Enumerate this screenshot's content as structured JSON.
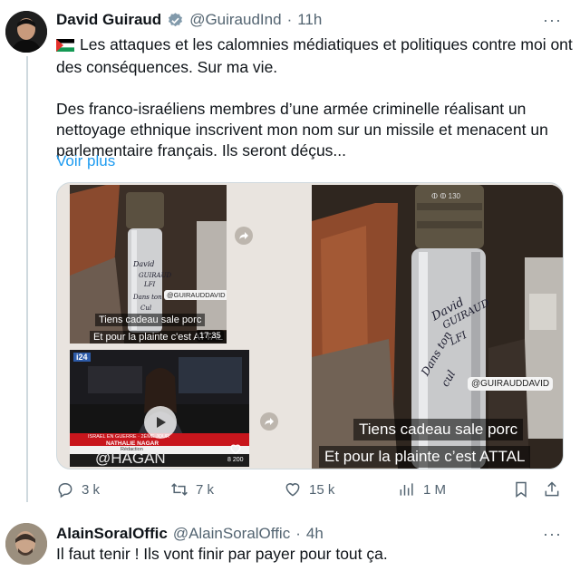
{
  "tweet": {
    "author_name": "David Guiraud",
    "handle": "@GuiraudInd",
    "separator": "·",
    "time": "11h",
    "more": "···",
    "flag_icon": "palestine-flag-icon",
    "line1": "Les attaques et les calomnies médiatiques et politiques contre moi ont",
    "line2": "des conséquences. Sur ma vie.",
    "line3": "Des franco-israéliens membres d’une armée criminelle réalisant un",
    "line4": "nettoyage ethnique inscrivent mon nom sur un missile et menacent un",
    "line5": "parlementaire français. Ils seront déçus...",
    "see_more": "Voir plus",
    "media": {
      "thumb1": {
        "watermark": "@GUIRAUDDAVID",
        "caption": "Tiens cadeau sale porc",
        "caption2": "Et pour la plainte c'est ATTAL",
        "duration": "17:35",
        "shell_writing": [
          "David",
          "GUIRAUD",
          "LFI",
          "Dans ton",
          "Cul"
        ]
      },
      "thumb2": {
        "channel": "i24",
        "banner_line1": "ISRAEL EN GUERRE · 2ÈME JOUR",
        "anchor": "NATHALIE NAGAR",
        "anchor_sub": "Rédaction",
        "handle_overlay": "@HAGAN",
        "counter": "8 200"
      },
      "main": {
        "shell_code": "ⵀ ⵀ 130",
        "writing": [
          "David",
          "GUIRAUD",
          "LFI",
          "Dans ton",
          "cul"
        ],
        "watermark": "@GUIRAUDDAVID",
        "caption1": "Tiens cadeau sale porc",
        "caption2": "Et pour la plainte c’est ATTAL"
      }
    },
    "actions": {
      "replies": "3 k",
      "retweets": "7 k",
      "likes": "15 k",
      "views": "1 M"
    }
  },
  "reply": {
    "author_name": "AlainSoralOffic",
    "handle": "@AlainSoralOffic",
    "separator": "·",
    "time": "4h",
    "more": "···",
    "text": "Il faut tenir ! Ils vont finir par payer pour tout ça."
  },
  "colors": {
    "accent": "#1d9bf0",
    "muted": "#536471",
    "verified": "#829aab",
    "text": "#0f1419"
  }
}
